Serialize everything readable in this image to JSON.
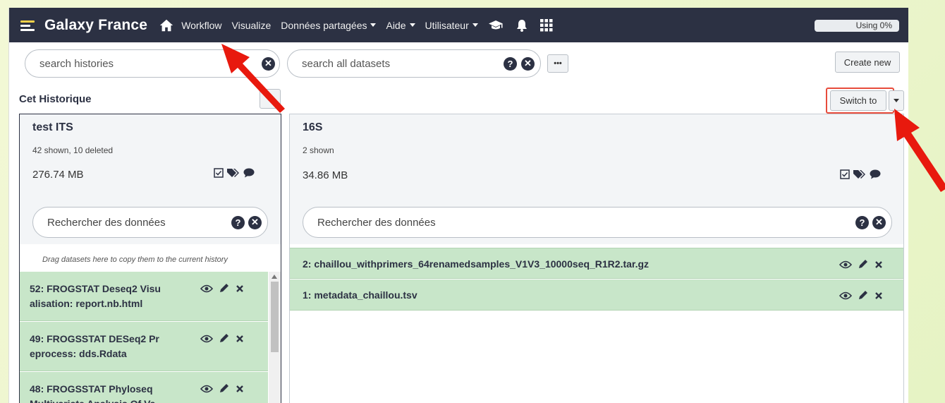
{
  "navbar": {
    "brand": "Galaxy France",
    "items": [
      {
        "label": "Workflow",
        "caret": false
      },
      {
        "label": "Visualize",
        "caret": false
      },
      {
        "label": "Données partagées",
        "caret": true
      },
      {
        "label": "Aide",
        "caret": true
      },
      {
        "label": "Utilisateur",
        "caret": true
      }
    ],
    "usage": "Using 0%"
  },
  "search": {
    "histories_placeholder": "search histories",
    "datasets_placeholder": "search all datasets",
    "more_label": "•••"
  },
  "buttons": {
    "create_new": "Create new",
    "switch_to": "Switch to"
  },
  "current_section_title": "Cet Historique",
  "left_history": {
    "name": "test ITS",
    "stats": "42 shown, 10 deleted",
    "size": "276.74 MB",
    "search_placeholder": "Rechercher des données",
    "drag_hint": "Drag datasets here to copy them to the current history",
    "datasets": [
      {
        "line1": "52: FROGSTAT Deseq2 Visu",
        "line2": "alisation: report.nb.html"
      },
      {
        "line1": "49: FROGSSTAT DESeq2 Pr",
        "line2": "eprocess: dds.Rdata"
      },
      {
        "line1": "48: FROGSSTAT Phyloseq",
        "line2": "Multivariate Analysis Of Va"
      }
    ]
  },
  "right_history": {
    "name": "16S",
    "stats": "2 shown",
    "size": "34.86 MB",
    "search_placeholder": "Rechercher des données",
    "datasets": [
      {
        "title": "2: chaillou_withprimers_64renamedsamples_V1V3_10000seq_R1R2.tar.gz"
      },
      {
        "title": "1: metadata_chaillou.tsv"
      }
    ]
  },
  "colors": {
    "navbar": "#2c3143",
    "dataset_ok": "#c8e6c9",
    "highlight": "#e74c3c",
    "arrow": "#e8190e"
  }
}
